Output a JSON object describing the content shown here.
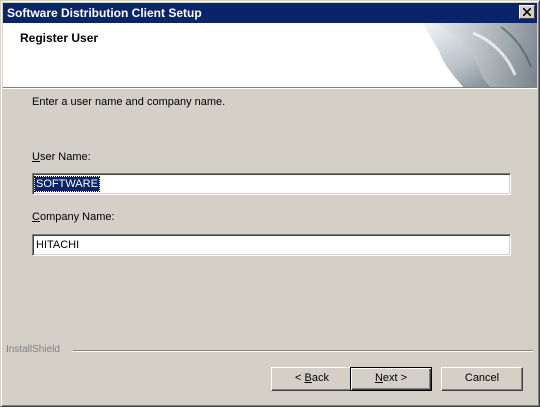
{
  "window": {
    "title": "Software Distribution Client Setup"
  },
  "header": {
    "title": "Register User"
  },
  "main": {
    "instruction": "Enter a user name and company name.",
    "user_name_label_key": "U",
    "user_name_label_rest": "ser Name:",
    "user_name_value": "SOFTWARE",
    "company_label_key": "C",
    "company_label_rest": "ompany Name:",
    "company_value": "HITACHI"
  },
  "footer": {
    "brand": "InstallShield",
    "back_prefix": "< ",
    "back_key": "B",
    "back_rest": "ack",
    "next_key": "N",
    "next_rest": "ext >",
    "cancel_label": "Cancel"
  },
  "colors": {
    "titlebar": "#0a246a",
    "dialog": "#d4d0c8",
    "selection": "#0a246a"
  },
  "icons": [
    "close-icon",
    "header-graphic"
  ]
}
